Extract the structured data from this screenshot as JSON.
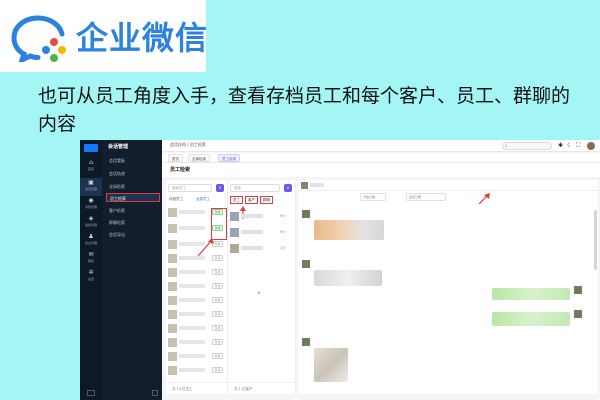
{
  "brand": {
    "name": "企业微信",
    "logo_icon": "wecom-logo-icon",
    "colors": {
      "blue": "#2b82e0",
      "green": "#4bb543",
      "yellow": "#f6b600",
      "red": "#e74c3c"
    }
  },
  "headline": "也可从员工角度入手，查看存档员工和每个客户、员工、群聊的内容",
  "screenshot": {
    "nav": {
      "items": [
        {
          "label": "首页",
          "icon": "home-icon"
        },
        {
          "label": "会话管理",
          "icon": "chat-icon"
        },
        {
          "label": "风险管理",
          "icon": "shield-icon"
        },
        {
          "label": "组织管理",
          "icon": "org-icon"
        },
        {
          "label": "企业管理",
          "icon": "person-icon"
        },
        {
          "label": "审批",
          "icon": "mail-icon"
        },
        {
          "label": "设置",
          "icon": "gear-icon"
        }
      ]
    },
    "subnav": {
      "title": "会话管理",
      "items": [
        "会话看板",
        "会话轨迹",
        "全局检索",
        "员工检索",
        "客户检索",
        "群聊检索",
        "会话导出"
      ],
      "active_index": 3
    },
    "topbar": {
      "breadcrumb": "会话存档 / 员工检索",
      "search_placeholder": "搜索"
    },
    "tabs": [
      {
        "label": "首页",
        "active": false
      },
      {
        "label": "全局检索",
        "active": false
      },
      {
        "label": "员工检索",
        "active": true
      }
    ],
    "page_title": "员工检索",
    "employee_col": {
      "search_placeholder": "搜索员工",
      "filters": [
        "存档员工",
        "全部员工"
      ],
      "active_filter_index": 1,
      "tags": [
        "存档",
        "存档",
        "存档",
        "存档",
        "存档",
        "存档",
        "存档",
        "存档",
        "存档",
        "存档",
        "存档",
        "存档",
        "存档",
        "存档"
      ],
      "footer": "共 14 位员工"
    },
    "contact_col": {
      "search_placeholder": "搜索",
      "chips": [
        "员工",
        "客户",
        "群聊"
      ],
      "meta": [
        "昨天",
        "昨天",
        "周四"
      ],
      "footer": "共 1 位客户"
    },
    "chat": {
      "date_from": "开始日期",
      "date_to": "结束日期"
    }
  }
}
